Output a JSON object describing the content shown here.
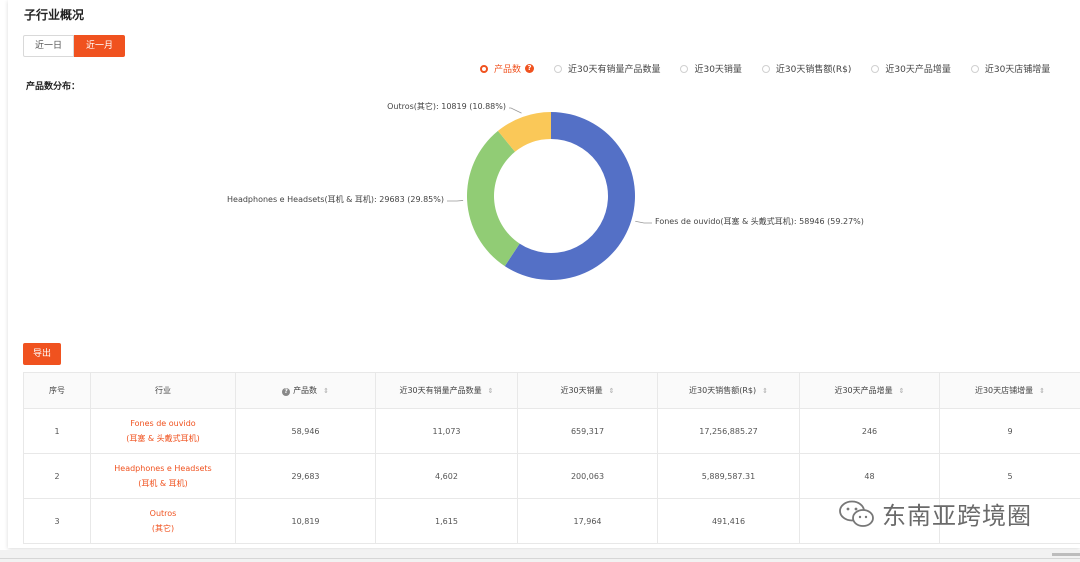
{
  "section_title": "子行业概况",
  "time_toggle": {
    "options": [
      "近一日",
      "近一月"
    ],
    "selected": "近一月"
  },
  "metric_tabs": {
    "items": [
      "产品数",
      "近30天有销量产品数量",
      "近30天销量",
      "近30天销售额(R$)",
      "近30天产品增量",
      "近30天店铺增量"
    ],
    "selected": "产品数",
    "help_icon": "question-circle-icon"
  },
  "distribution_label": "产品数分布：",
  "chart_data": {
    "type": "pie",
    "donut": true,
    "slices": [
      {
        "name": "Fones de ouvido(耳塞 & 头戴式耳机)",
        "value": 58946,
        "percent": 59.27,
        "label": "Fones de ouvido(耳塞 & 头戴式耳机): 58946 (59.27%)",
        "color": "#5470c6"
      },
      {
        "name": "Headphones e Headsets(耳机 & 耳机)",
        "value": 29683,
        "percent": 29.85,
        "label": "Headphones e Headsets(耳机 & 耳机): 29683 (29.85%)",
        "color": "#91cc75"
      },
      {
        "name": "Outros(其它)",
        "value": 10819,
        "percent": 10.88,
        "label": "Outros(其它): 10819 (10.88%)",
        "color": "#fac858"
      }
    ]
  },
  "export_label": "导出",
  "table": {
    "columns": [
      "序号",
      "行业",
      "产品数",
      "近30天有销量产品数量",
      "近30天销量",
      "近30天销售额(R$)",
      "近30天产品增量",
      "近30天店铺增量"
    ],
    "rows": [
      {
        "idx": "1",
        "industry_line1": "Fones de ouvido",
        "industry_line2": "(耳塞 & 头戴式耳机)",
        "products": "58,946",
        "with_sales": "11,073",
        "sales": "659,317",
        "revenue": "17,256,885.27",
        "prod_inc": "246",
        "shop_inc": "9"
      },
      {
        "idx": "2",
        "industry_line1": "Headphones e Headsets",
        "industry_line2": "(耳机 & 耳机)",
        "products": "29,683",
        "with_sales": "4,602",
        "sales": "200,063",
        "revenue": "5,889,587.31",
        "prod_inc": "48",
        "shop_inc": "5"
      },
      {
        "idx": "3",
        "industry_line1": "Outros",
        "industry_line2": "(其它)",
        "products": "10,819",
        "with_sales": "1,615",
        "sales": "17,964",
        "revenue": "491,416",
        "prod_inc": "",
        "shop_inc": ""
      }
    ]
  },
  "watermark": {
    "text": "东南亚跨境圈",
    "icon": "wechat-icon"
  },
  "colors": {
    "accent": "#f0521f"
  }
}
